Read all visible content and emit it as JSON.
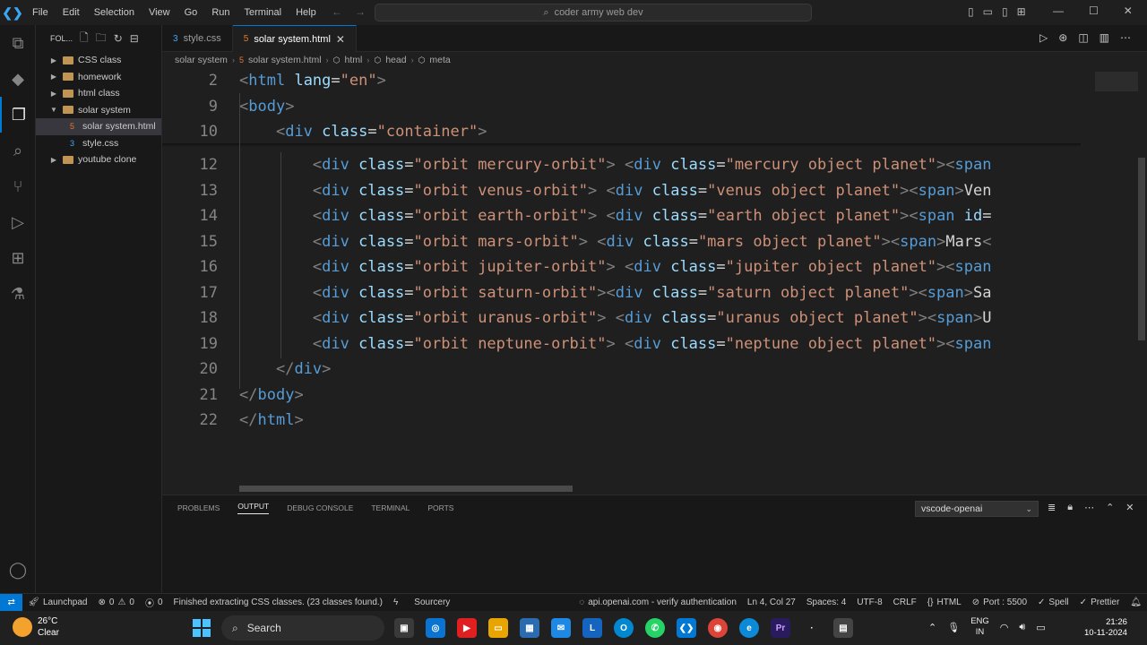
{
  "titlebar": {
    "menu": [
      "File",
      "Edit",
      "Selection",
      "View",
      "Go",
      "Run",
      "Terminal",
      "Help"
    ],
    "search": "coder army web dev"
  },
  "sidebar": {
    "header": "FOL...",
    "items": [
      {
        "label": "CSS class",
        "type": "folder",
        "expanded": false
      },
      {
        "label": "homework",
        "type": "folder",
        "expanded": false
      },
      {
        "label": "html class",
        "type": "folder",
        "expanded": false
      },
      {
        "label": "solar system",
        "type": "folder",
        "expanded": true
      },
      {
        "label": "solar system.html",
        "type": "html-file",
        "selected": true
      },
      {
        "label": "style.css",
        "type": "css-file"
      },
      {
        "label": "youtube clone",
        "type": "folder",
        "expanded": false
      }
    ]
  },
  "tabs": [
    {
      "label": "style.css",
      "active": false
    },
    {
      "label": "solar system.html",
      "active": true
    }
  ],
  "breadcrumb": [
    "solar system",
    "solar system.html",
    "html",
    "head",
    "meta"
  ],
  "editor": {
    "sticky": [
      {
        "num": "2",
        "indent": "",
        "parts": [
          [
            "tag",
            "<"
          ],
          [
            "tn",
            "html"
          ],
          [
            "tx",
            " "
          ],
          [
            "an",
            "lang"
          ],
          [
            "tx",
            "="
          ],
          [
            "av",
            "\"en\""
          ],
          [
            "tag",
            ">"
          ]
        ]
      },
      {
        "num": "9",
        "indent": "",
        "parts": [
          [
            "tag",
            "<"
          ],
          [
            "tn",
            "body"
          ],
          [
            "tag",
            ">"
          ]
        ]
      },
      {
        "num": "10",
        "indent": "    ",
        "parts": [
          [
            "tag",
            "<"
          ],
          [
            "tn",
            "div"
          ],
          [
            "tx",
            " "
          ],
          [
            "an",
            "class"
          ],
          [
            "tx",
            "="
          ],
          [
            "av",
            "\"container\""
          ],
          [
            "tag",
            ">"
          ]
        ]
      }
    ],
    "lines": [
      {
        "num": "12",
        "indent": "        ",
        "parts": [
          [
            "tag",
            "<"
          ],
          [
            "tn",
            "div"
          ],
          [
            "tx",
            " "
          ],
          [
            "an",
            "class"
          ],
          [
            "tx",
            "="
          ],
          [
            "av",
            "\"orbit mercury-orbit\""
          ],
          [
            "tag",
            ">"
          ],
          [
            "tx",
            " "
          ],
          [
            "tag",
            "<"
          ],
          [
            "tn",
            "div"
          ],
          [
            "tx",
            " "
          ],
          [
            "an",
            "class"
          ],
          [
            "tx",
            "="
          ],
          [
            "av",
            "\"mercury object planet\""
          ],
          [
            "tag",
            "><"
          ],
          [
            "tn",
            "span"
          ]
        ]
      },
      {
        "num": "13",
        "indent": "        ",
        "parts": [
          [
            "tag",
            "<"
          ],
          [
            "tn",
            "div"
          ],
          [
            "tx",
            " "
          ],
          [
            "an",
            "class"
          ],
          [
            "tx",
            "="
          ],
          [
            "av",
            "\"orbit venus-orbit\""
          ],
          [
            "tag",
            ">"
          ],
          [
            "tx",
            " "
          ],
          [
            "tag",
            "<"
          ],
          [
            "tn",
            "div"
          ],
          [
            "tx",
            " "
          ],
          [
            "an",
            "class"
          ],
          [
            "tx",
            "="
          ],
          [
            "av",
            "\"venus object planet\""
          ],
          [
            "tag",
            "><"
          ],
          [
            "tn",
            "span"
          ],
          [
            "tag",
            ">"
          ],
          [
            "tx",
            "Ven"
          ]
        ]
      },
      {
        "num": "14",
        "indent": "        ",
        "parts": [
          [
            "tag",
            "<"
          ],
          [
            "tn",
            "div"
          ],
          [
            "tx",
            " "
          ],
          [
            "an",
            "class"
          ],
          [
            "tx",
            "="
          ],
          [
            "av",
            "\"orbit earth-orbit\""
          ],
          [
            "tag",
            ">"
          ],
          [
            "tx",
            " "
          ],
          [
            "tag",
            "<"
          ],
          [
            "tn",
            "div"
          ],
          [
            "tx",
            " "
          ],
          [
            "an",
            "class"
          ],
          [
            "tx",
            "="
          ],
          [
            "av",
            "\"earth object planet\""
          ],
          [
            "tag",
            "><"
          ],
          [
            "tn",
            "span"
          ],
          [
            "tx",
            " "
          ],
          [
            "an",
            "id"
          ],
          [
            "tx",
            "="
          ]
        ]
      },
      {
        "num": "15",
        "indent": "        ",
        "parts": [
          [
            "tag",
            "<"
          ],
          [
            "tn",
            "div"
          ],
          [
            "tx",
            " "
          ],
          [
            "an",
            "class"
          ],
          [
            "tx",
            "="
          ],
          [
            "av",
            "\"orbit mars-orbit\""
          ],
          [
            "tag",
            ">"
          ],
          [
            "tx",
            " "
          ],
          [
            "tag",
            "<"
          ],
          [
            "tn",
            "div"
          ],
          [
            "tx",
            " "
          ],
          [
            "an",
            "class"
          ],
          [
            "tx",
            "="
          ],
          [
            "av",
            "\"mars object planet\""
          ],
          [
            "tag",
            "><"
          ],
          [
            "tn",
            "span"
          ],
          [
            "tag",
            ">"
          ],
          [
            "tx",
            "Mars"
          ],
          [
            "tag",
            "<"
          ]
        ]
      },
      {
        "num": "16",
        "indent": "        ",
        "parts": [
          [
            "tag",
            "<"
          ],
          [
            "tn",
            "div"
          ],
          [
            "tx",
            " "
          ],
          [
            "an",
            "class"
          ],
          [
            "tx",
            "="
          ],
          [
            "av",
            "\"orbit jupiter-orbit\""
          ],
          [
            "tag",
            ">"
          ],
          [
            "tx",
            " "
          ],
          [
            "tag",
            "<"
          ],
          [
            "tn",
            "div"
          ],
          [
            "tx",
            " "
          ],
          [
            "an",
            "class"
          ],
          [
            "tx",
            "="
          ],
          [
            "av",
            "\"jupiter object planet\""
          ],
          [
            "tag",
            "><"
          ],
          [
            "tn",
            "span"
          ]
        ]
      },
      {
        "num": "17",
        "indent": "        ",
        "parts": [
          [
            "tag",
            "<"
          ],
          [
            "tn",
            "div"
          ],
          [
            "tx",
            " "
          ],
          [
            "an",
            "class"
          ],
          [
            "tx",
            "="
          ],
          [
            "av",
            "\"orbit saturn-orbit\""
          ],
          [
            "tag",
            "><"
          ],
          [
            "tn",
            "div"
          ],
          [
            "tx",
            " "
          ],
          [
            "an",
            "class"
          ],
          [
            "tx",
            "="
          ],
          [
            "av",
            "\"saturn object planet\""
          ],
          [
            "tag",
            "><"
          ],
          [
            "tn",
            "span"
          ],
          [
            "tag",
            ">"
          ],
          [
            "tx",
            "Sa"
          ]
        ]
      },
      {
        "num": "18",
        "indent": "        ",
        "parts": [
          [
            "tag",
            "<"
          ],
          [
            "tn",
            "div"
          ],
          [
            "tx",
            " "
          ],
          [
            "an",
            "class"
          ],
          [
            "tx",
            "="
          ],
          [
            "av",
            "\"orbit uranus-orbit\""
          ],
          [
            "tag",
            ">"
          ],
          [
            "tx",
            " "
          ],
          [
            "tag",
            "<"
          ],
          [
            "tn",
            "div"
          ],
          [
            "tx",
            " "
          ],
          [
            "an",
            "class"
          ],
          [
            "tx",
            "="
          ],
          [
            "av",
            "\"uranus object planet\""
          ],
          [
            "tag",
            "><"
          ],
          [
            "tn",
            "span"
          ],
          [
            "tag",
            ">"
          ],
          [
            "tx",
            "U"
          ]
        ]
      },
      {
        "num": "19",
        "indent": "        ",
        "parts": [
          [
            "tag",
            "<"
          ],
          [
            "tn",
            "div"
          ],
          [
            "tx",
            " "
          ],
          [
            "an",
            "class"
          ],
          [
            "tx",
            "="
          ],
          [
            "av",
            "\"orbit neptune-orbit\""
          ],
          [
            "tag",
            ">"
          ],
          [
            "tx",
            " "
          ],
          [
            "tag",
            "<"
          ],
          [
            "tn",
            "div"
          ],
          [
            "tx",
            " "
          ],
          [
            "an",
            "class"
          ],
          [
            "tx",
            "="
          ],
          [
            "av",
            "\"neptune object planet\""
          ],
          [
            "tag",
            "><"
          ],
          [
            "tn",
            "span"
          ]
        ]
      },
      {
        "num": "20",
        "indent": "    ",
        "parts": [
          [
            "tag",
            "</"
          ],
          [
            "tn",
            "div"
          ],
          [
            "tag",
            ">"
          ]
        ]
      },
      {
        "num": "21",
        "indent": "",
        "parts": [
          [
            "tag",
            "</"
          ],
          [
            "tn",
            "body"
          ],
          [
            "tag",
            ">"
          ]
        ]
      },
      {
        "num": "22",
        "indent": "",
        "parts": [
          [
            "tag",
            "</"
          ],
          [
            "tn",
            "html"
          ],
          [
            "tag",
            ">"
          ]
        ]
      }
    ]
  },
  "panel": {
    "tabs": [
      "PROBLEMS",
      "OUTPUT",
      "DEBUG CONSOLE",
      "TERMINAL",
      "PORTS"
    ],
    "active_tab": "OUTPUT",
    "output_channel": "vscode-openai"
  },
  "statusbar": {
    "launchpad": "Launchpad",
    "errors": "0",
    "warnings": "0",
    "ports_count": "0",
    "message": "Finished extracting CSS classes. (23 classes found.)",
    "sourcery": "Sourcery",
    "openai": "api.openai.com - verify authentication",
    "position": "Ln 4, Col 27",
    "spaces": "Spaces: 4",
    "encoding": "UTF-8",
    "eol": "CRLF",
    "language": "HTML",
    "port": "Port : 5500",
    "spell": "Spell",
    "prettier": "Prettier"
  },
  "taskbar": {
    "temp": "26°C",
    "weather": "Clear",
    "search": "Search",
    "lang1": "ENG",
    "lang2": "IN",
    "time": "21:26",
    "date": "10-11-2024"
  },
  "colors": {
    "accent": "#0078d4",
    "editor_bg": "#1f1f1f",
    "tag_name": "#569cd6",
    "attr_name": "#9cdcfe",
    "attr_value": "#ce9178"
  }
}
